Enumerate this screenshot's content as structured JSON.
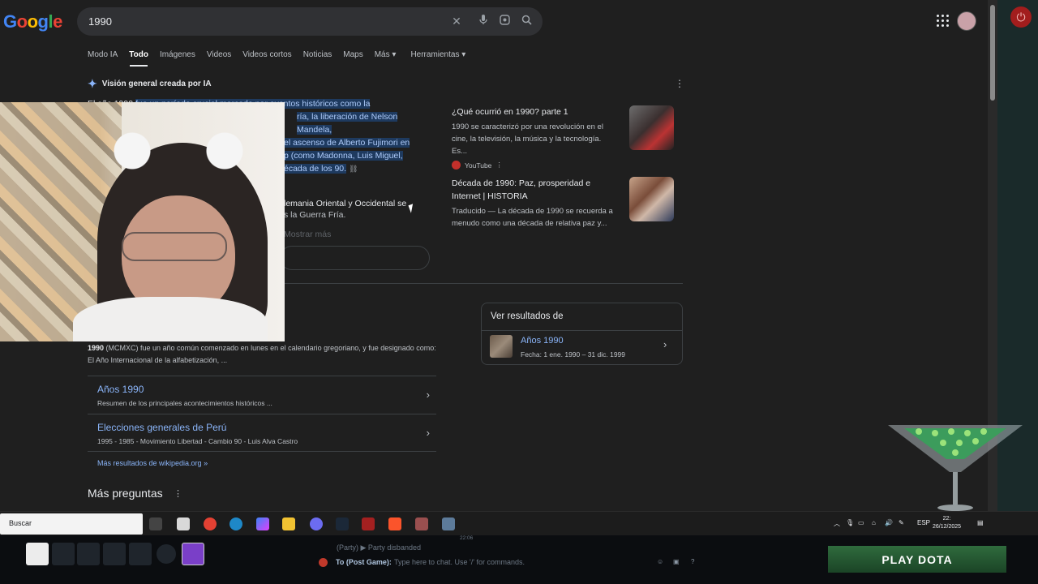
{
  "header": {
    "logo_letters": [
      "G",
      "o",
      "o",
      "g",
      "l",
      "e"
    ],
    "query": "1990"
  },
  "tabs": [
    {
      "label": "Modo IA",
      "active": false
    },
    {
      "label": "Todo",
      "active": true
    },
    {
      "label": "Imágenes",
      "active": false
    },
    {
      "label": "Videos",
      "active": false
    },
    {
      "label": "Videos cortos",
      "active": false
    },
    {
      "label": "Noticias",
      "active": false
    },
    {
      "label": "Maps",
      "active": false
    },
    {
      "label": "Más",
      "active": false
    },
    {
      "label": "Herramientas",
      "active": false
    }
  ],
  "ai_overview": {
    "heading": "Visión general creada por IA",
    "text_line1_pre": "El año 1990 ",
    "text_line1_hl": "fue un período crucial marcado por eventos históricos como la",
    "text_line2_hl": "ría, la liberación de Nelson Mandela,",
    "text_line3_hl": "el ascenso de Alberto Fujimori en",
    "text_line4_hl": "p (como Madonna, Luis Miguel,",
    "text_line5_hl": "écada de los 90.",
    "para2_line1": "lemania Oriental y Occidental se",
    "para2_line2": "s la Guerra Fría.",
    "faded": "Mostrar más"
  },
  "cards": [
    {
      "title": "¿Qué ocurrió en 1990? parte 1",
      "desc": "1990 se caracterizó por una revolución en el cine, la televisión, la música y la tecnología. Es...",
      "source": "YouTube"
    },
    {
      "title": "Década de 1990: Paz, prosperidad e Internet | HISTORIA",
      "desc": "Traducido — La década de 1990 se recuerda a menudo como una década de relativa paz y..."
    }
  ],
  "ver_resultados": {
    "title": "Ver resultados de",
    "link": "Años 1990",
    "sub": "Fecha: 1 ene. 1990 – 31 dic. 1999"
  },
  "wiki": {
    "bold": "1990",
    "text": " (MCMXC) fue un año común comenzado en lunes en el calendario gregoriano, y fue designado como: El Año Internacional de la alfabetización, ...",
    "rows": [
      {
        "link": "Años 1990",
        "sub": "Resumen de los principales acontecimientos históricos ..."
      },
      {
        "link": "Elecciones generales de Perú",
        "sub": "1995 - 1985 - Movimiento Libertad - Cambio 90 - Luis Alva Castro"
      }
    ],
    "more": "Más resultados de wikipedia.org »"
  },
  "mas_preguntas": "Más preguntas",
  "taskbar": {
    "search_placeholder": "Buscar",
    "lang": "ESP",
    "time": "22:",
    "date": "26/12/2025"
  },
  "game": {
    "time": "22:06",
    "status": "(Party) ▶ Party disbanded",
    "chat_label": "To (Post Game):",
    "chat_placeholder": "Type here to chat. Use '/' for commands.",
    "play_button": "PLAY DOTA"
  }
}
